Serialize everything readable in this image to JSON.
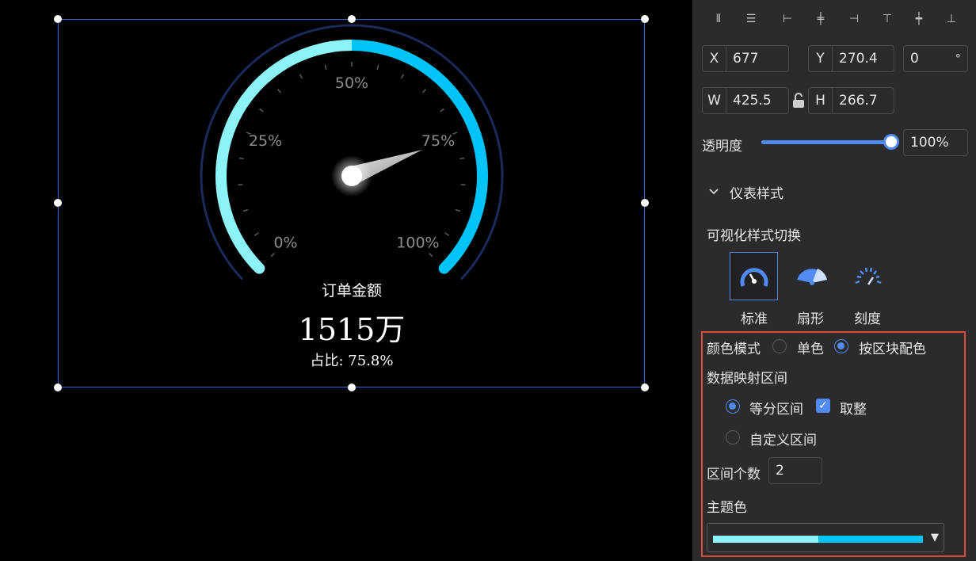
{
  "gauge": {
    "name": "订单金额",
    "value_text": "1515万",
    "ratio_text": "占比: 75.8%",
    "percent": 0.758,
    "tick_labels": [
      "0%",
      "25%",
      "50%",
      "75%",
      "100%"
    ],
    "colors": {
      "band_1": "#8cf3f9",
      "band_2": "#00c4f8",
      "outer_ring": "#1b2a5a"
    }
  },
  "panel": {
    "position": {
      "x_label": "X",
      "x_value": "677",
      "y_label": "Y",
      "y_value": "270.4",
      "rotation_value": "0",
      "rotation_unit": "°",
      "w_label": "W",
      "w_value": "425.5",
      "h_label": "H",
      "h_value": "266.7"
    },
    "opacity": {
      "label": "透明度",
      "value_text": "100%",
      "value": 1.0
    },
    "section_title": "仪表样式",
    "style_switch_label": "可视化样式切换",
    "styles": [
      {
        "label": "标准",
        "icon": "gauge-standard-icon",
        "active": true
      },
      {
        "label": "扇形",
        "icon": "gauge-fan-icon",
        "active": false
      },
      {
        "label": "刻度",
        "icon": "gauge-scale-icon",
        "active": false
      }
    ],
    "color_mode": {
      "label": "颜色模式",
      "options": [
        "单色",
        "按区块配色"
      ],
      "selected": "按区块配色"
    },
    "mapping": {
      "label": "数据映射区间",
      "equal_label": "等分区间",
      "round_label": "取整",
      "custom_label": "自定义区间",
      "selected": "等分区间",
      "round_checked": true
    },
    "interval_count": {
      "label": "区间个数",
      "value": "2"
    },
    "theme_color": {
      "label": "主题色",
      "colors": [
        "#8cf3f9",
        "#00c4f8"
      ]
    },
    "accent": "#4f8bf0"
  }
}
